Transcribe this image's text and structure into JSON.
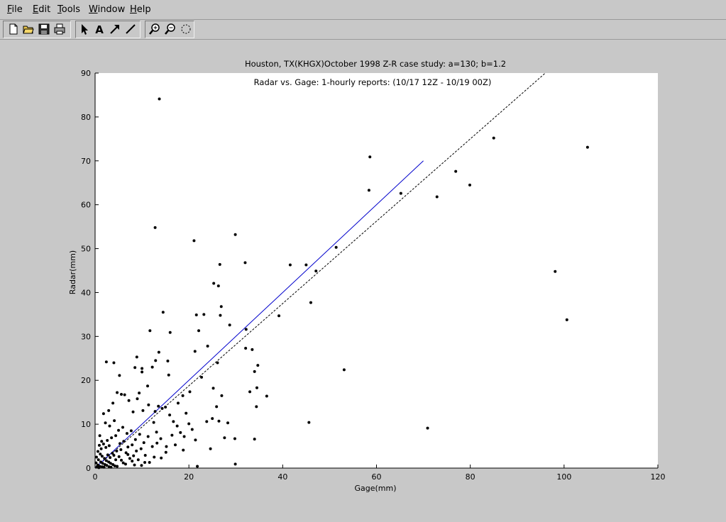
{
  "menus": {
    "file": {
      "mn": "F",
      "rest": "ile"
    },
    "edit": {
      "mn": "E",
      "rest": "dit"
    },
    "tools": {
      "mn": "T",
      "rest": "ools"
    },
    "window": {
      "mn": "W",
      "rest": "indow"
    },
    "help": {
      "mn": "H",
      "rest": "elp"
    }
  },
  "toolbar_icons": [
    "new-file-icon",
    "open-folder-icon",
    "save-icon",
    "print-icon",
    "select-arrow-icon",
    "text-tool-icon",
    "arrow-tool-icon",
    "line-tool-icon",
    "zoom-in-icon",
    "zoom-out-icon",
    "rotate-icon"
  ],
  "chart_data": {
    "type": "scatter",
    "title": "Houston, TX(KHGX)October 1998 Z-R case study: a=130; b=1.2",
    "subtitle": "Radar vs. Gage: 1-hourly reports: (10/17 12Z - 10/19 00Z)",
    "xlabel": "Gage(mm)",
    "ylabel": "Radar(mm)",
    "xlim": [
      0,
      120
    ],
    "ylim": [
      0,
      90
    ],
    "xticks": [
      "0",
      "20",
      "40",
      "60",
      "80",
      "100",
      "120"
    ],
    "yticks": [
      "0",
      "10",
      "20",
      "30",
      "40",
      "50",
      "60",
      "70",
      "80",
      "90"
    ],
    "grid": false,
    "colors": {
      "points": "#000000",
      "fit_line": "#0000cc",
      "one_to_one_line": "#000000"
    },
    "fit_line": {
      "x": [
        0,
        70
      ],
      "y": [
        0,
        70
      ]
    },
    "one_to_one_line": {
      "x": [
        0,
        96
      ],
      "y": [
        0,
        90
      ]
    },
    "points": [
      [
        13.7,
        84.1
      ],
      [
        12.8,
        54.8
      ],
      [
        21.1,
        51.8
      ],
      [
        29.9,
        53.2
      ],
      [
        32,
        46.8
      ],
      [
        26.6,
        46.4
      ],
      [
        25.3,
        42.1
      ],
      [
        26.3,
        41.5
      ],
      [
        41.6,
        46.3
      ],
      [
        45,
        46.3
      ],
      [
        47.1,
        44.9
      ],
      [
        51.4,
        50.3
      ],
      [
        58.6,
        70.9
      ],
      [
        58.4,
        63.3
      ],
      [
        65.2,
        62.6
      ],
      [
        72.9,
        61.8
      ],
      [
        76.9,
        67.6
      ],
      [
        79.9,
        64.5
      ],
      [
        85,
        75.2
      ],
      [
        105,
        73.1
      ],
      [
        98.1,
        44.8
      ],
      [
        100.6,
        33.8
      ],
      [
        46,
        37.7
      ],
      [
        39.2,
        34.7
      ],
      [
        53.1,
        22.4
      ],
      [
        70.9,
        9.1
      ],
      [
        45.6,
        10.4
      ],
      [
        36.6,
        16.4
      ],
      [
        34.7,
        23.4
      ],
      [
        34,
        22
      ],
      [
        33.5,
        27
      ],
      [
        32.2,
        31.6
      ],
      [
        32.1,
        27.3
      ],
      [
        28.7,
        32.6
      ],
      [
        26.9,
        36.8
      ],
      [
        26.7,
        34.8
      ],
      [
        23.2,
        35
      ],
      [
        21.6,
        34.9
      ],
      [
        14.5,
        35.5
      ],
      [
        16,
        30.9
      ],
      [
        11.7,
        31.3
      ],
      [
        13.6,
        26.4
      ],
      [
        15.5,
        24.4
      ],
      [
        15.7,
        21.2
      ],
      [
        12.9,
        24.5
      ],
      [
        12.2,
        23
      ],
      [
        10,
        21.9
      ],
      [
        10,
        22.7
      ],
      [
        8.9,
        25.3
      ],
      [
        8.5,
        22.9
      ],
      [
        5.2,
        21.1
      ],
      [
        2.4,
        24.2
      ],
      [
        4,
        24
      ],
      [
        22.7,
        20.7
      ],
      [
        20.2,
        17.4
      ],
      [
        18.7,
        16.5
      ],
      [
        17.7,
        14.8
      ],
      [
        19.4,
        12.5
      ],
      [
        20.7,
        8.8
      ],
      [
        20,
        10.1
      ],
      [
        22.1,
        31.3
      ],
      [
        21.3,
        26.6
      ],
      [
        24,
        27.8
      ],
      [
        23.8,
        10.6
      ],
      [
        24.6,
        4.4
      ],
      [
        27.6,
        6.9
      ],
      [
        28.3,
        10.3
      ],
      [
        29.8,
        6.7
      ],
      [
        29.9,
        0.9
      ],
      [
        21.8,
        0.4
      ],
      [
        26.1,
        24
      ],
      [
        25.9,
        14
      ],
      [
        26.4,
        10.7
      ],
      [
        27,
        16.5
      ],
      [
        33,
        17.4
      ],
      [
        34.4,
        14
      ],
      [
        34.5,
        18.3
      ],
      [
        34,
        6.6
      ],
      [
        25.2,
        18.2
      ],
      [
        25,
        11.3
      ],
      [
        1.8,
        12.4
      ],
      [
        2.9,
        13.1
      ],
      [
        3.8,
        14.8
      ],
      [
        4.7,
        17.2
      ],
      [
        5.6,
        16.8
      ],
      [
        6.3,
        16.7
      ],
      [
        7.2,
        15.4
      ],
      [
        8.1,
        12.8
      ],
      [
        9,
        15.8
      ],
      [
        10.2,
        13.1
      ],
      [
        11.4,
        14.4
      ],
      [
        12.8,
        12.9
      ],
      [
        13.5,
        14.1
      ],
      [
        14.3,
        13.6
      ],
      [
        15,
        13.9
      ],
      [
        15.9,
        12.1
      ],
      [
        16.7,
        10.6
      ],
      [
        17.5,
        9.6
      ],
      [
        18.2,
        8.1
      ],
      [
        19,
        7.2
      ],
      [
        9.4,
        17.1
      ],
      [
        11.2,
        18.7
      ],
      [
        12.5,
        10.4
      ],
      [
        13.1,
        8.2
      ],
      [
        14,
        6.7
      ],
      [
        15.2,
        4.9
      ],
      [
        16.4,
        7.5
      ],
      [
        17.1,
        5.3
      ],
      [
        18.8,
        4.1
      ],
      [
        21.4,
        6.4
      ],
      [
        2.2,
        10.3
      ],
      [
        3.1,
        9.6
      ],
      [
        4.1,
        10.8
      ],
      [
        5,
        8.6
      ],
      [
        5.9,
        9.3
      ],
      [
        6.8,
        7.9
      ],
      [
        7.7,
        8.5
      ],
      [
        8.6,
        6.5
      ],
      [
        9.5,
        7.7
      ],
      [
        10.4,
        5.8
      ],
      [
        11.3,
        7.2
      ],
      [
        12.2,
        4.9
      ],
      [
        13.2,
        5.7
      ],
      [
        14.1,
        2.3
      ],
      [
        15.1,
        3.6
      ],
      [
        3.5,
        6.9
      ],
      [
        4.4,
        7.4
      ],
      [
        5.3,
        5.6
      ],
      [
        6.1,
        6.1
      ],
      [
        7,
        4.8
      ],
      [
        7.9,
        5.3
      ],
      [
        8.8,
        3.9
      ],
      [
        9.8,
        4.4
      ],
      [
        10.7,
        2.9
      ],
      [
        11.6,
        1.3
      ],
      [
        12.6,
        2.5
      ],
      [
        1,
        7.4
      ],
      [
        1.4,
        6.1
      ],
      [
        1.8,
        5.5
      ],
      [
        2.3,
        4.7
      ],
      [
        0.6,
        3.8
      ],
      [
        1.1,
        3.2
      ],
      [
        1.5,
        2.7
      ],
      [
        2,
        2.2
      ],
      [
        2.4,
        1.7
      ],
      [
        2.9,
        1.4
      ],
      [
        3.3,
        1.1
      ],
      [
        3.8,
        0.8
      ],
      [
        4.2,
        0.5
      ],
      [
        4.7,
        0.4
      ],
      [
        0.3,
        2.5
      ],
      [
        0.7,
        1.9
      ],
      [
        1.2,
        1.4
      ],
      [
        1.6,
        1.1
      ],
      [
        2.1,
        0.8
      ],
      [
        2.5,
        0.6
      ],
      [
        3,
        0.3
      ],
      [
        3.4,
        0.2
      ],
      [
        0.2,
        1.2
      ],
      [
        0.6,
        0.7
      ],
      [
        1,
        0.4
      ],
      [
        1.5,
        0.3
      ],
      [
        1.9,
        0.2
      ],
      [
        0.4,
        0.3
      ],
      [
        0.8,
        0.1
      ],
      [
        5.1,
        2.6
      ],
      [
        5.6,
        1.8
      ],
      [
        6,
        1.2
      ],
      [
        6.5,
        0.9
      ],
      [
        7,
        3.1
      ],
      [
        7.4,
        2.2
      ],
      [
        7.9,
        1.6
      ],
      [
        8.4,
        0.7
      ],
      [
        9.2,
        1.9
      ],
      [
        9.9,
        0.6
      ],
      [
        10.6,
        1.3
      ],
      [
        3.7,
        3.4
      ],
      [
        4.6,
        3.9
      ],
      [
        5.5,
        4.2
      ],
      [
        6.6,
        3.5
      ],
      [
        8.2,
        2.8
      ],
      [
        3,
        5.1
      ],
      [
        2.6,
        6.3
      ],
      [
        2.7,
        3
      ],
      [
        3.2,
        2.4
      ],
      [
        4,
        2.9
      ],
      [
        4.4,
        1.9
      ],
      [
        0.9,
        5.2
      ],
      [
        1.3,
        4.4
      ],
      [
        0.5,
        0.4
      ]
    ]
  }
}
